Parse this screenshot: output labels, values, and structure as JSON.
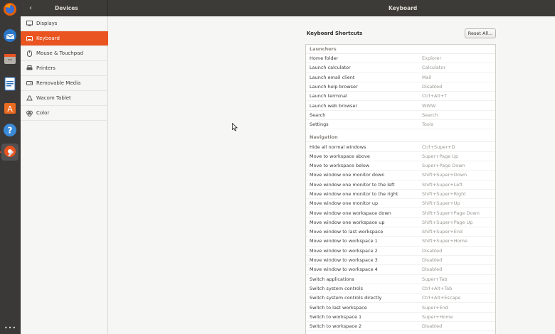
{
  "header": {
    "back_icon": "chevron-left-icon",
    "panel_title": "Devices",
    "window_title": "Keyboard"
  },
  "dock": {
    "items": [
      {
        "icon": "firefox-icon"
      },
      {
        "icon": "thunderbird-icon"
      },
      {
        "icon": "files-icon"
      },
      {
        "icon": "writer-icon"
      },
      {
        "icon": "software-icon"
      },
      {
        "icon": "help-icon"
      },
      {
        "icon": "settings-icon"
      }
    ],
    "apps_icon": "show-applications-icon"
  },
  "sidebar": {
    "items": [
      {
        "label": "Displays",
        "icon": "display-icon"
      },
      {
        "label": "Keyboard",
        "icon": "keyboard-icon"
      },
      {
        "label": "Mouse & Touchpad",
        "icon": "mouse-icon"
      },
      {
        "label": "Printers",
        "icon": "printer-icon"
      },
      {
        "label": "Removable Media",
        "icon": "media-icon"
      },
      {
        "label": "Wacom Tablet",
        "icon": "tablet-icon"
      },
      {
        "label": "Color",
        "icon": "color-icon"
      }
    ],
    "selected": "Keyboard"
  },
  "main": {
    "section_title": "Keyboard Shortcuts",
    "reset_label": "Reset All...",
    "groups": [
      {
        "title": "Launchers",
        "rows": [
          {
            "name": "Home folder",
            "accel": "Explorer"
          },
          {
            "name": "Launch calculator",
            "accel": "Calculator"
          },
          {
            "name": "Launch email client",
            "accel": "Mail"
          },
          {
            "name": "Launch help browser",
            "accel": "Disabled"
          },
          {
            "name": "Launch terminal",
            "accel": "Ctrl+Alt+T"
          },
          {
            "name": "Launch web browser",
            "accel": "WWW"
          },
          {
            "name": "Search",
            "accel": "Search"
          },
          {
            "name": "Settings",
            "accel": "Tools"
          }
        ]
      },
      {
        "title": "Navigation",
        "rows": [
          {
            "name": "Hide all normal windows",
            "accel": "Ctrl+Super+D"
          },
          {
            "name": "Move to workspace above",
            "accel": "Super+Page Up"
          },
          {
            "name": "Move to workspace below",
            "accel": "Super+Page Down"
          },
          {
            "name": "Move window one monitor down",
            "accel": "Shift+Super+Down"
          },
          {
            "name": "Move window one monitor to the left",
            "accel": "Shift+Super+Left"
          },
          {
            "name": "Move window one monitor to the right",
            "accel": "Shift+Super+Right"
          },
          {
            "name": "Move window one monitor up",
            "accel": "Shift+Super+Up"
          },
          {
            "name": "Move window one workspace down",
            "accel": "Shift+Super+Page Down"
          },
          {
            "name": "Move window one workspace up",
            "accel": "Shift+Super+Page Up"
          },
          {
            "name": "Move window to last workspace",
            "accel": "Shift+Super+End"
          },
          {
            "name": "Move window to workspace 1",
            "accel": "Shift+Super+Home"
          },
          {
            "name": "Move window to workspace 2",
            "accel": "Disabled"
          },
          {
            "name": "Move window to workspace 3",
            "accel": "Disabled"
          },
          {
            "name": "Move window to workspace 4",
            "accel": "Disabled"
          },
          {
            "name": "Switch applications",
            "accel": "Super+Tab"
          },
          {
            "name": "Switch system controls",
            "accel": "Ctrl+Alt+Tab"
          },
          {
            "name": "Switch system controls directly",
            "accel": "Ctrl+Alt+Escape"
          },
          {
            "name": "Switch to last workspace",
            "accel": "Super+End"
          },
          {
            "name": "Switch to workspace 1",
            "accel": "Super+Home"
          },
          {
            "name": "Switch to workspace 2",
            "accel": "Disabled"
          }
        ]
      }
    ]
  },
  "colors": {
    "accent": "#e95420",
    "headerbar": "#3c3b37",
    "dock": "#3b3838"
  }
}
